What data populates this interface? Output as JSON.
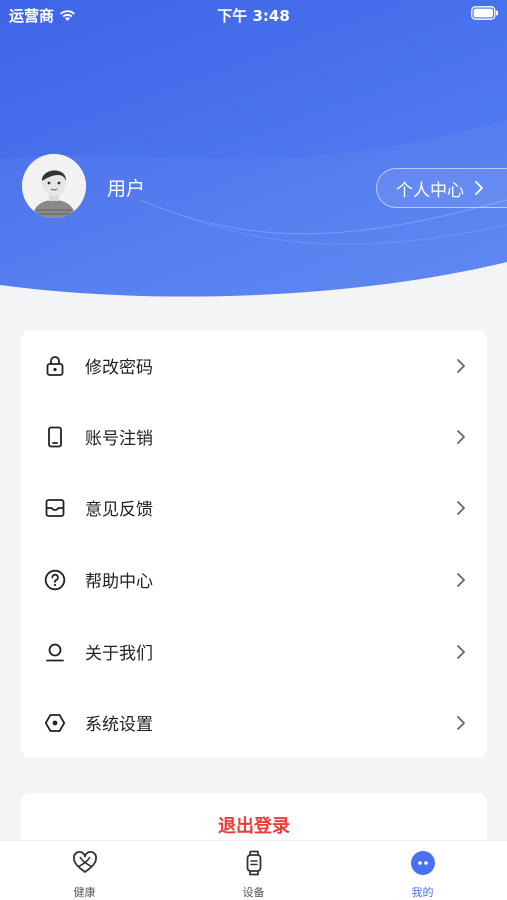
{
  "status_bar": {
    "carrier": "运营商",
    "time": "下午 3:48"
  },
  "user": {
    "name": "用户",
    "profile_button": "个人中心"
  },
  "menu": {
    "items": [
      {
        "label": "修改密码",
        "icon": "lock-icon"
      },
      {
        "label": "账号注销",
        "icon": "phone-icon"
      },
      {
        "label": "意见反馈",
        "icon": "inbox-icon"
      },
      {
        "label": "帮助中心",
        "icon": "question-icon"
      },
      {
        "label": "关于我们",
        "icon": "person-icon"
      },
      {
        "label": "系统设置",
        "icon": "settings-icon"
      }
    ]
  },
  "logout": {
    "label": "退出登录",
    "color": "#ee3b3b"
  },
  "tabbar": {
    "tabs": [
      {
        "label": "健康",
        "icon": "heart-icon"
      },
      {
        "label": "设备",
        "icon": "watch-icon"
      },
      {
        "label": "我的",
        "icon": "profile-icon"
      }
    ],
    "active_index": 2,
    "active_color": "#4a72f0"
  },
  "colors": {
    "header_gradient_start": "#3f64e8",
    "header_gradient_end": "#5b86f4",
    "background": "#f3f4f6"
  }
}
